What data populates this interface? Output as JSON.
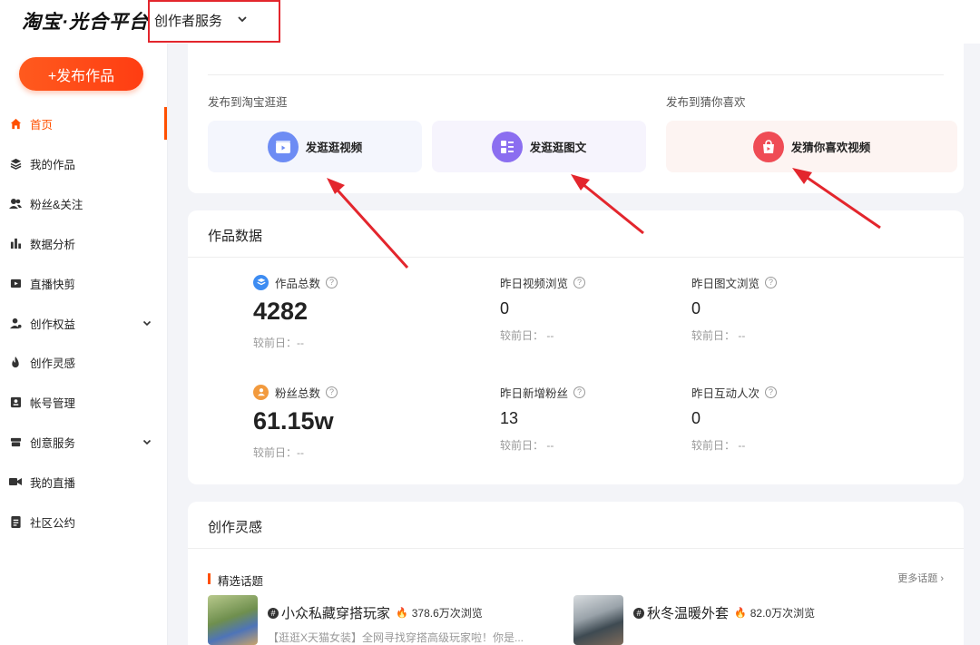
{
  "header": {
    "logo": "淘宝·光合平台",
    "creator_menu": "创作者服务"
  },
  "sidebar": {
    "publish_label": "+发布作品",
    "items": [
      {
        "label": "首页",
        "icon": "home-icon",
        "active": true
      },
      {
        "label": "我的作品",
        "icon": "layers-icon"
      },
      {
        "label": "粉丝&关注",
        "icon": "users-icon"
      },
      {
        "label": "数据分析",
        "icon": "bar-chart-icon"
      },
      {
        "label": "直播快剪",
        "icon": "video-clip-icon"
      },
      {
        "label": "创作权益",
        "icon": "user-badge-icon",
        "expandable": true
      },
      {
        "label": "创作灵感",
        "icon": "flame-icon"
      },
      {
        "label": "帐号管理",
        "icon": "id-card-icon"
      },
      {
        "label": "创意服务",
        "icon": "box-icon",
        "expandable": true
      },
      {
        "label": "我的直播",
        "icon": "camera-icon"
      },
      {
        "label": "社区公约",
        "icon": "document-icon"
      }
    ]
  },
  "publish": {
    "taobao_label": "发布到淘宝逛逛",
    "guess_label": "发布到猜你喜欢",
    "video_button": "发逛逛视频",
    "article_button": "发逛逛图文",
    "guess_button": "发猜你喜欢视频"
  },
  "works_data": {
    "title": "作品数据",
    "stats": [
      {
        "label": "作品总数",
        "value": "4282",
        "compare": "较前日：--"
      },
      {
        "label": "昨日视频浏览",
        "value": "0",
        "compare": "较前日： --"
      },
      {
        "label": "昨日图文浏览",
        "value": "0",
        "compare": "较前日： --"
      },
      {
        "label": "粉丝总数",
        "value": "61.15w",
        "compare": "较前日：--"
      },
      {
        "label": "昨日新增粉丝",
        "value": "13",
        "compare": "较前日： --"
      },
      {
        "label": "昨日互动人次",
        "value": "0",
        "compare": "较前日： --"
      }
    ]
  },
  "inspiration": {
    "title": "创作灵感",
    "topics_label": "精选话题",
    "more_label": "更多话题",
    "topics": [
      {
        "title": "小众私藏穿搭玩家",
        "views": "378.6万次浏览",
        "desc": "【逛逛X天猫女装】全网寻找穿搭高级玩家啦！你是..."
      },
      {
        "title": "秋冬温暖外套",
        "views": "82.0万次浏览",
        "desc": ""
      }
    ]
  },
  "colors": {
    "accent": "#ff5000",
    "annotation_red": "#e3262d"
  }
}
